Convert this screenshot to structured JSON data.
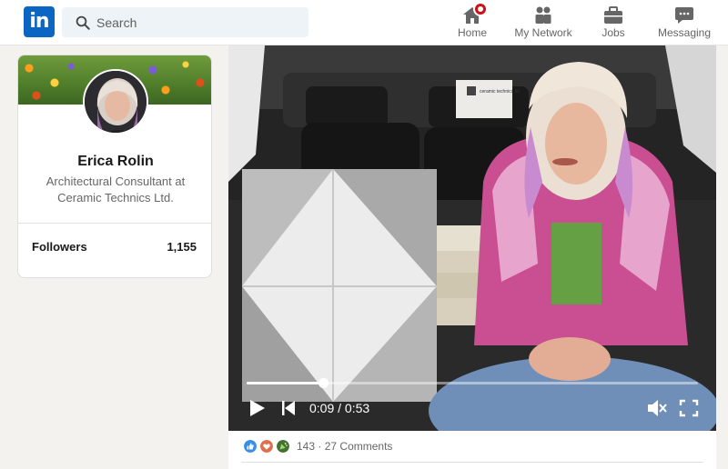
{
  "brand": {
    "logo_text": "in",
    "color": "#0a66c2"
  },
  "search": {
    "placeholder": "Search",
    "icon": "search-icon"
  },
  "nav": {
    "items": [
      {
        "label": "Home",
        "icon": "home-icon",
        "has_notification": true
      },
      {
        "label": "My Network",
        "icon": "network-icon"
      },
      {
        "label": "Jobs",
        "icon": "briefcase-icon"
      },
      {
        "label": "Messaging",
        "icon": "message-icon"
      }
    ]
  },
  "profile": {
    "name": "Erica Rolin",
    "headline": "Architectural Consultant at Ceramic Technics Ltd.",
    "followers_label": "Followers",
    "followers_count": "1,155"
  },
  "video": {
    "current_time": "0:09",
    "duration": "0:53",
    "time_display": "0:09 / 0:53",
    "progress_fraction": 0.17,
    "muted": true,
    "box_label": "ceramic technics ltd"
  },
  "social": {
    "reactions": [
      "like",
      "love",
      "celebrate"
    ],
    "reaction_count": "143",
    "comments": "27 Comments",
    "separator": "·"
  }
}
